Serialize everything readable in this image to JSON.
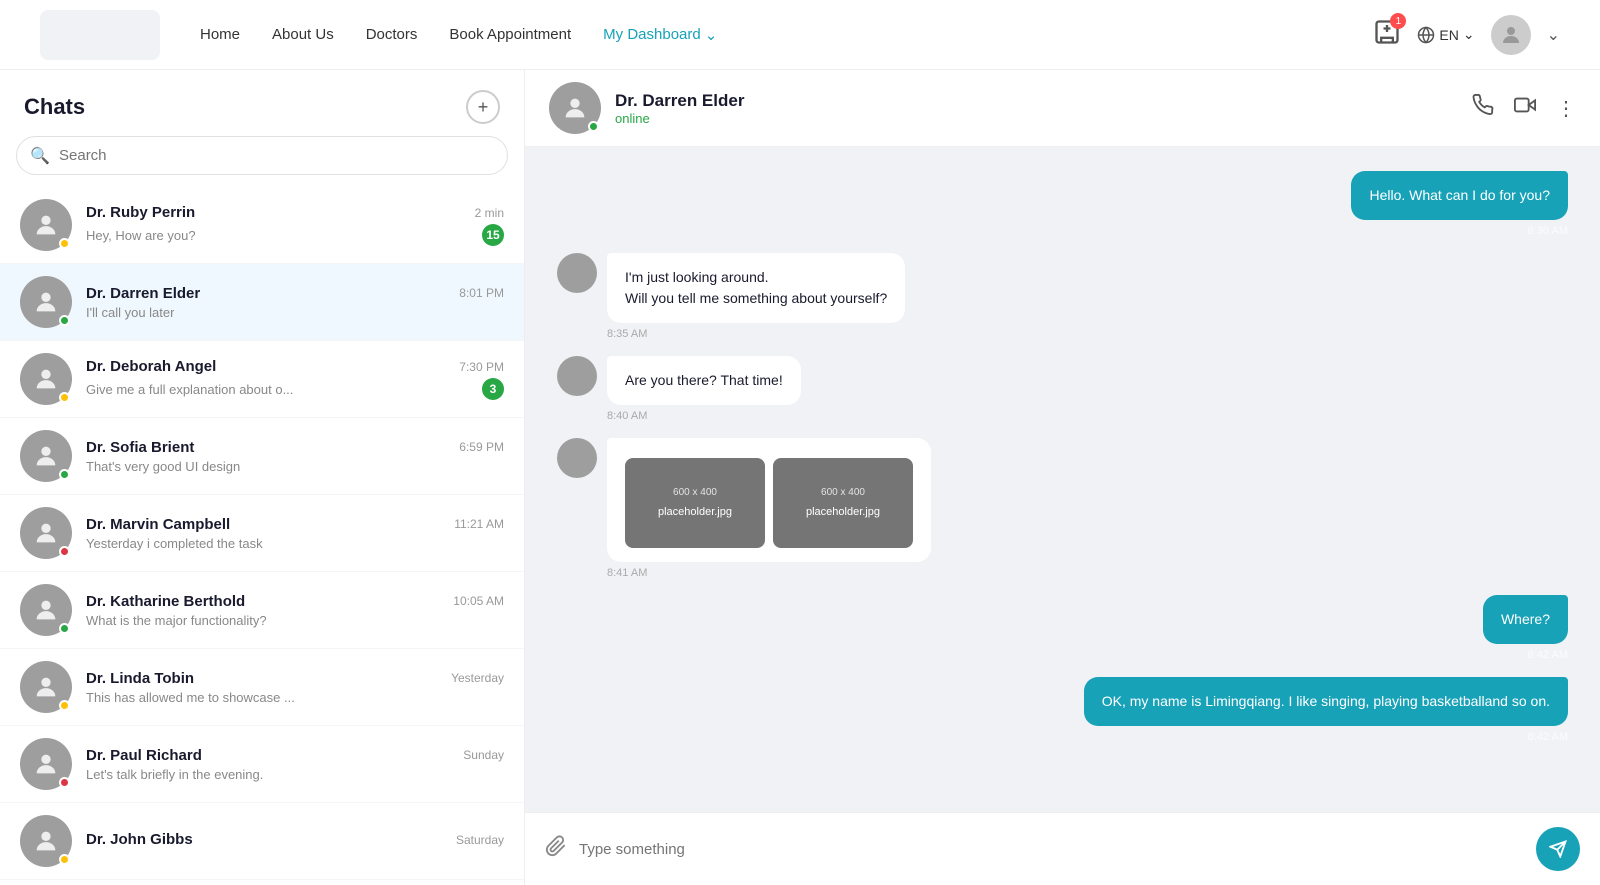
{
  "navbar": {
    "links": [
      {
        "label": "Home",
        "active": false
      },
      {
        "label": "About Us",
        "active": false
      },
      {
        "label": "Doctors",
        "active": false
      },
      {
        "label": "Book Appointment",
        "active": false
      },
      {
        "label": "My Dashboard",
        "active": true,
        "hasChevron": true
      }
    ],
    "lang": "EN",
    "notification_count": "1"
  },
  "sidebar": {
    "title": "Chats",
    "search_placeholder": "Search",
    "chats": [
      {
        "id": 1,
        "name": "Dr. Ruby Perrin",
        "preview": "Hey, How are you?",
        "time": "2 min",
        "unread": 15,
        "status": "away"
      },
      {
        "id": 2,
        "name": "Dr. Darren Elder",
        "preview": "I'll call you later",
        "time": "8:01 PM",
        "unread": 0,
        "status": "online",
        "active": true
      },
      {
        "id": 3,
        "name": "Dr. Deborah Angel",
        "preview": "Give me a full explanation about o...",
        "time": "7:30 PM",
        "unread": 3,
        "status": "away"
      },
      {
        "id": 4,
        "name": "Dr. Sofia Brient",
        "preview": "That's very good UI design",
        "time": "6:59 PM",
        "unread": 0,
        "status": "online"
      },
      {
        "id": 5,
        "name": "Dr. Marvin Campbell",
        "preview": "Yesterday i completed the task",
        "time": "11:21 AM",
        "unread": 0,
        "status": "offline"
      },
      {
        "id": 6,
        "name": "Dr. Katharine Berthold",
        "preview": "What is the major functionality?",
        "time": "10:05 AM",
        "unread": 0,
        "status": "online"
      },
      {
        "id": 7,
        "name": "Dr. Linda Tobin",
        "preview": "This has allowed me to showcase ...",
        "time": "Yesterday",
        "unread": 0,
        "status": "away"
      },
      {
        "id": 8,
        "name": "Dr. Paul Richard",
        "preview": "Let's talk briefly in the evening.",
        "time": "Sunday",
        "unread": 0,
        "status": "offline"
      },
      {
        "id": 9,
        "name": "Dr. John Gibbs",
        "preview": "",
        "time": "Saturday",
        "unread": 0,
        "status": "away"
      }
    ]
  },
  "chat": {
    "contact_name": "Dr. Darren Elder",
    "contact_status": "online",
    "messages": [
      {
        "id": 1,
        "type": "sent",
        "text": "Hello. What can I do for you?",
        "time": "8:30 AM",
        "has_images": false
      },
      {
        "id": 2,
        "type": "received",
        "text": "I'm just looking around.\nWill you tell me something about yourself?",
        "time": "8:35 AM",
        "has_images": false
      },
      {
        "id": 3,
        "type": "received",
        "text": "Are you there? That time!",
        "time": "8:40 AM",
        "has_images": false
      },
      {
        "id": 4,
        "type": "received",
        "text": "",
        "time": "8:41 AM",
        "has_images": true,
        "images": [
          {
            "dim": "600 x 400",
            "label": "placeholder.jpg"
          },
          {
            "dim": "600 x 400",
            "label": "placeholder.jpg"
          }
        ]
      },
      {
        "id": 5,
        "type": "sent",
        "text": "Where?",
        "time": "8:42 AM",
        "has_images": false
      },
      {
        "id": 6,
        "type": "sent",
        "text": "OK, my name is Limingqiang. I like singing, playing basketballand so on.",
        "time": "8:42 AM",
        "has_images": false
      }
    ],
    "input_placeholder": "Type something"
  }
}
